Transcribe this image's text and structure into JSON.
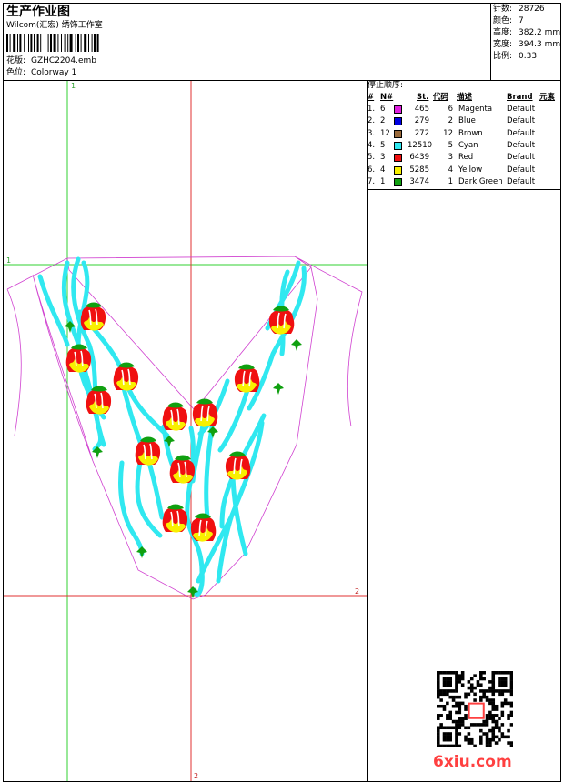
{
  "header": {
    "title": "生产作业图",
    "subtitle": "Wilcom(汇宏) 绣饰工作室",
    "design_label": "花版:",
    "design_value": "GZHC2204.emb",
    "colorway_label": "色位:",
    "colorway_value": "Colorway 1"
  },
  "stats": [
    {
      "label": "针数:",
      "value": "28726"
    },
    {
      "label": "颜色:",
      "value": "7"
    },
    {
      "label": "高度:",
      "value": "382.2 mm"
    },
    {
      "label": "宽度:",
      "value": "394.3 mm"
    },
    {
      "label": "比例:",
      "value": "0.33"
    }
  ],
  "stop_sequence": {
    "title": "停止顺序:",
    "headers": [
      "#",
      "N#",
      "St.",
      "代码",
      "描述",
      "Brand",
      "元素"
    ],
    "rows": [
      {
        "seq": "1.",
        "needle": "6",
        "color": "#e020e0",
        "stitches": "465",
        "code": "6",
        "desc": "Magenta",
        "brand": "Default"
      },
      {
        "seq": "2.",
        "needle": "2",
        "color": "#0000e0",
        "stitches": "279",
        "code": "2",
        "desc": "Blue",
        "brand": "Default"
      },
      {
        "seq": "3.",
        "needle": "12",
        "color": "#9a6a3a",
        "stitches": "272",
        "code": "12",
        "desc": "Brown",
        "brand": "Default"
      },
      {
        "seq": "4.",
        "needle": "5",
        "color": "#30e8f0",
        "stitches": "12510",
        "code": "5",
        "desc": "Cyan",
        "brand": "Default"
      },
      {
        "seq": "5.",
        "needle": "3",
        "color": "#f01010",
        "stitches": "6439",
        "code": "3",
        "desc": "Red",
        "brand": "Default"
      },
      {
        "seq": "6.",
        "needle": "4",
        "color": "#f8f000",
        "stitches": "5285",
        "code": "4",
        "desc": "Yellow",
        "brand": "Default"
      },
      {
        "seq": "7.",
        "needle": "1",
        "color": "#10a010",
        "stitches": "3474",
        "code": "1",
        "desc": "Dark Green",
        "brand": "Default"
      }
    ]
  },
  "guides": {
    "v1": "1",
    "v2": "2",
    "h1": "1",
    "h2": "2"
  },
  "watermark": "6xiu.com",
  "watermark_color": "#ff4040"
}
